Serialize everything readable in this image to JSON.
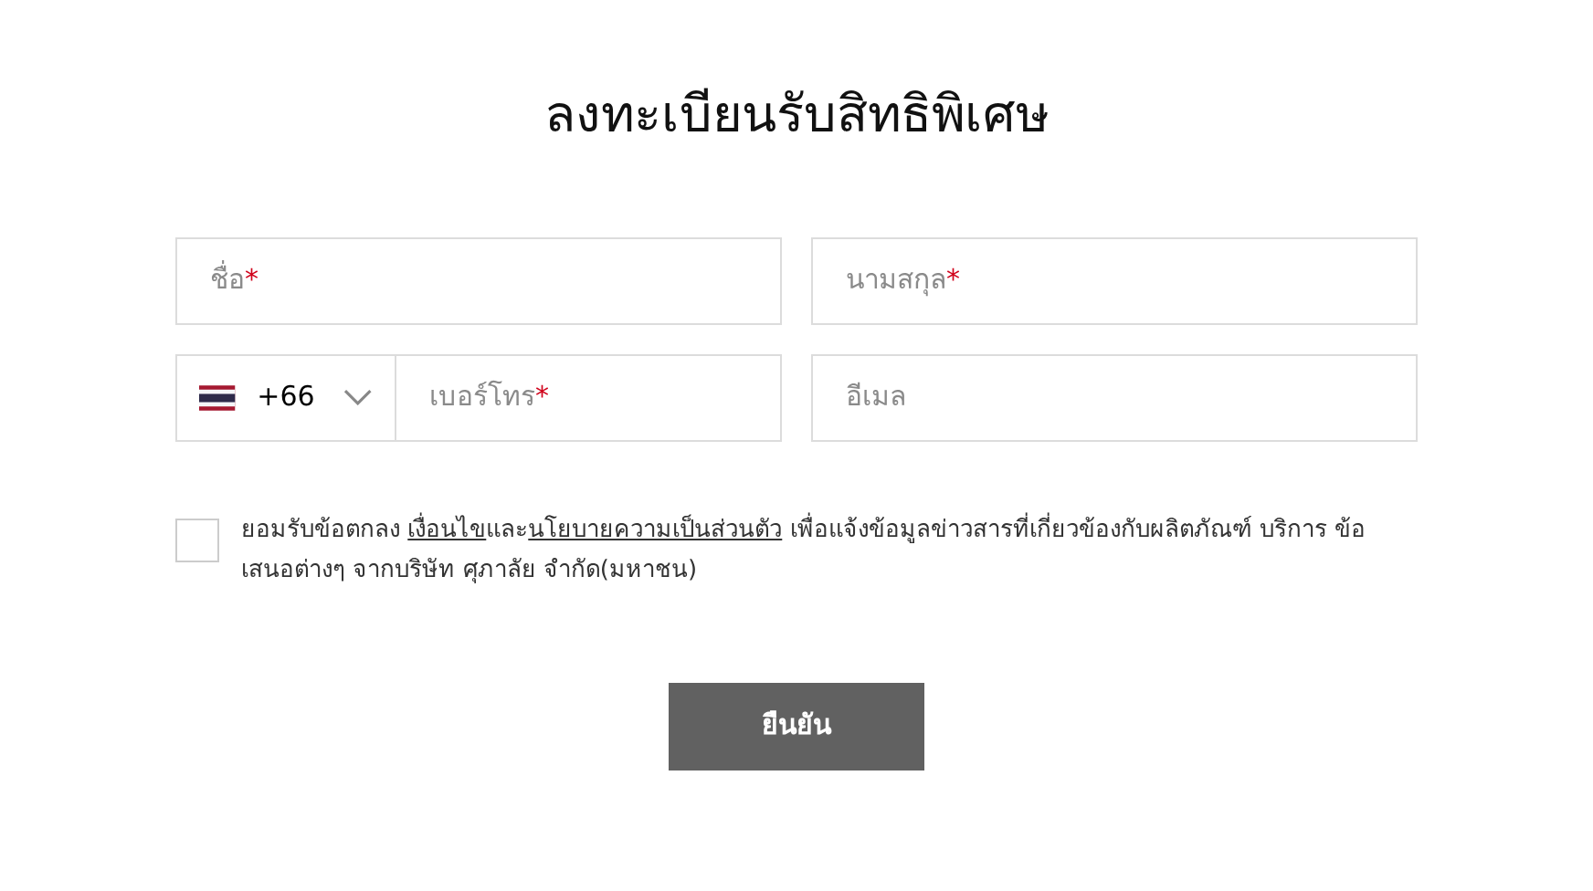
{
  "title": "ลงทะเบียนรับสิทธิพิเศษ",
  "fields": [
    {
      "kind": "text",
      "placeholder": "ชื่อ",
      "required_mark": "*"
    },
    {
      "kind": "text",
      "placeholder": "นามสกุล",
      "required_mark": "*"
    },
    {
      "kind": "phone",
      "country_code": "+66",
      "placeholder": "เบอร์โทร",
      "required_mark": "*"
    },
    {
      "kind": "text",
      "placeholder": "อีเมล"
    }
  ],
  "consent": {
    "checked": false,
    "text_before": "ยอมรับข้อตกลง ",
    "link_1": "เงื่อนไข",
    "text_middle": "และ",
    "link_2": "นโยบายความเป็นส่วนตัว",
    "text_after": " เพื่อแจ้งข้อมูลข่าวสารที่เกี่ยวข้องกับผลิตภัณฑ์ บริการ ข้อเสนอต่างๆ จากบริษัท ศุภาลัย จำกัด(มหาชน)"
  },
  "submit_button": "ยืนยัน"
}
